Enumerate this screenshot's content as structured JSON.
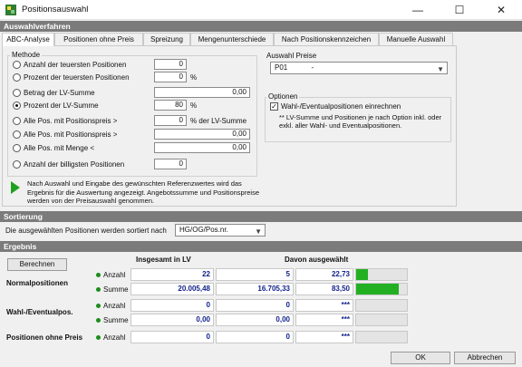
{
  "window": {
    "title": "Positionsauswahl",
    "minimize": "—",
    "maximize": "☐",
    "close": "✕"
  },
  "sections": {
    "auswahlverfahren": "Auswahlverfahren",
    "sortierung": "Sortierung",
    "ergebnis": "Ergebnis"
  },
  "tabs": [
    "ABC-Analyse",
    "Positionen ohne Preis",
    "Spreizung",
    "Mengenunterschiede",
    "Nach Positionskennzeichen",
    "Manuelle Auswahl"
  ],
  "methode": {
    "label": "Methode",
    "options": [
      {
        "label": "Anzahl der teuersten Positionen",
        "value": "0",
        "unit": ""
      },
      {
        "label": "Prozent der teuersten Positionen",
        "value": "0",
        "unit": "%"
      },
      {
        "label": "Betrag der LV-Summe",
        "value": "0,00",
        "unit": ""
      },
      {
        "label": "Prozent der LV-Summe",
        "value": "80",
        "unit": "%"
      },
      {
        "label": "Alle Pos. mit Positionspreis >",
        "value": "0",
        "unit": "% der LV-Summe"
      },
      {
        "label": "Alle Pos. mit Positionspreis >",
        "value": "0,00",
        "unit": ""
      },
      {
        "label": "Alle Pos. mit Menge <",
        "value": "0,00",
        "unit": ""
      },
      {
        "label": "Anzahl der billigsten Positionen",
        "value": "0",
        "unit": ""
      }
    ],
    "selected_index": 3
  },
  "auswahl_preise": {
    "label": "Auswahl Preise",
    "code": "P01",
    "value": "-"
  },
  "optionen": {
    "label": "Optionen",
    "checkbox_label": "Wahl-/Eventualpositionen einrechnen",
    "checked": true,
    "note": "** LV-Summe und Positionen je nach Option inkl. oder exkl. aller Wahl- und Eventualpositionen."
  },
  "hint": "Nach Auswahl und Eingabe des gewünschten Referenzwertes wird das Ergebnis für die Auswertung angezeigt. Angebotssumme und Positionspreise werden von der Preisauswahl genommen.",
  "sortierung": {
    "label": "Die ausgewählten Positionen werden sortiert nach",
    "value": "HG/OG/Pos.nr."
  },
  "ergebnis": {
    "button": "Berechnen",
    "col_total": "Insgesamt in LV",
    "col_selected": "Davon ausgewählt",
    "groups": [
      {
        "name": "Normalpositionen",
        "rows": [
          {
            "label": "Anzahl",
            "total": "22",
            "selected": "5",
            "percent": "22,73",
            "fill": 0.2273
          },
          {
            "label": "Summe",
            "total": "20.005,48",
            "selected": "16.705,33",
            "percent": "83,50",
            "fill": 0.835
          }
        ]
      },
      {
        "name": "Wahl-/Eventualpos.",
        "rows": [
          {
            "label": "Anzahl",
            "total": "0",
            "selected": "0",
            "percent": "***",
            "fill": 0
          },
          {
            "label": "Summe",
            "total": "0,00",
            "selected": "0,00",
            "percent": "***",
            "fill": 0
          }
        ]
      },
      {
        "name": "Positionen ohne Preis",
        "rows": [
          {
            "label": "Anzahl",
            "total": "0",
            "selected": "0",
            "percent": "***",
            "fill": 0
          }
        ]
      }
    ]
  },
  "buttons": {
    "ok": "OK",
    "cancel": "Abbrechen"
  },
  "colors": {
    "section": "#7b7b7b",
    "bar_fill": "#22b022",
    "value_text": "#0e1f8a"
  }
}
